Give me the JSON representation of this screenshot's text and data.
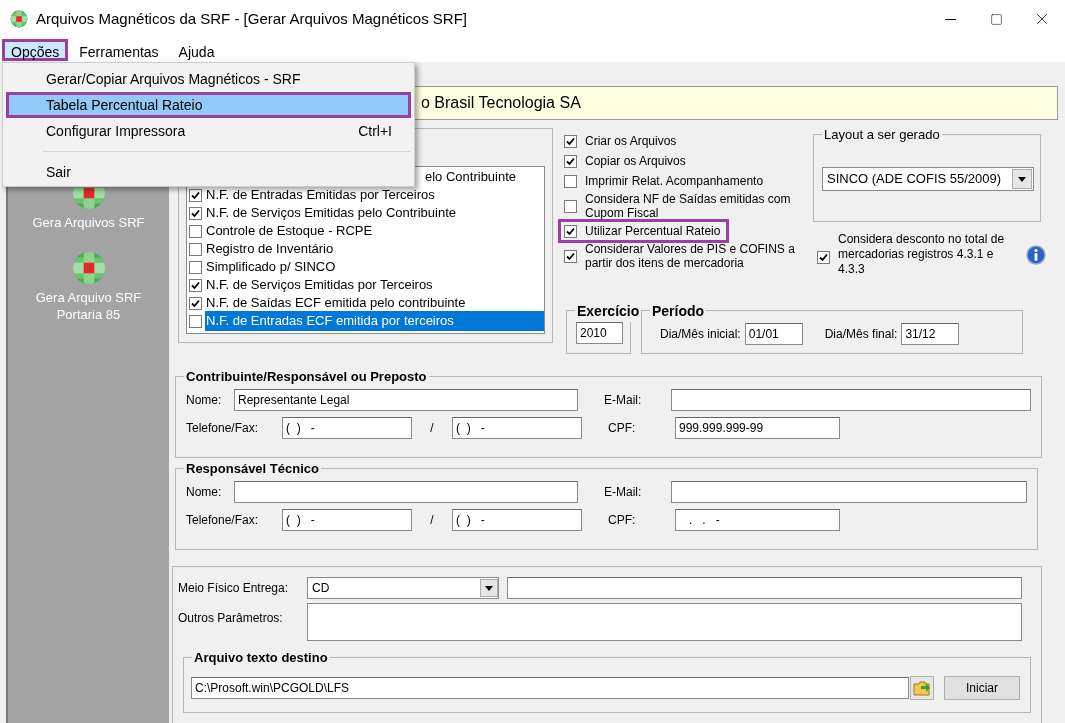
{
  "window": {
    "title": "Arquivos Magnéticos da SRF - [Gerar Arquivos Magnéticos SRF]"
  },
  "menu_bar": [
    {
      "label": "Opções",
      "selected": true,
      "highlighted": true
    },
    {
      "label": "Ferramentas",
      "selected": false,
      "highlighted": false
    },
    {
      "label": "Ajuda",
      "selected": false,
      "highlighted": false
    }
  ],
  "menu": {
    "items": [
      {
        "kind": "item",
        "label": "Gerar/Copiar Arquivos Magnéticos - SRF",
        "selected": false,
        "highlighted": false
      },
      {
        "kind": "item",
        "label": "Tabela Percentual Rateio",
        "selected": true,
        "highlighted": true
      },
      {
        "kind": "item",
        "label": "Configurar Impressora",
        "shortcut": "Ctrl+I",
        "selected": false,
        "highlighted": false
      },
      {
        "kind": "separator"
      },
      {
        "kind": "item",
        "label": "Sair",
        "selected": false,
        "highlighted": false
      }
    ]
  },
  "sidebar": {
    "items": [
      {
        "label": "Gera Arquivos SRF"
      },
      {
        "label": "Gera Arquivo SRF Portaria 85"
      }
    ]
  },
  "company_field": {
    "value": "o Brasil Tecnologia SA"
  },
  "file_list": {
    "items": [
      {
        "kind": "cut",
        "label": "elo Contribuinte"
      },
      {
        "kind": "row",
        "label": "N.F. de Entradas Emitidas por Terceiros",
        "checked": true,
        "selected": false
      },
      {
        "kind": "row",
        "label": "N.F. de Serviços Emitidas pelo Contribuinte",
        "checked": true,
        "selected": false
      },
      {
        "kind": "row",
        "label": "Controle de Estoque - RCPE",
        "checked": false,
        "selected": false
      },
      {
        "kind": "row",
        "label": "Registro de Inventário",
        "checked": false,
        "selected": false
      },
      {
        "kind": "row",
        "label": "Simplificado p/ SINCO",
        "checked": false,
        "selected": false
      },
      {
        "kind": "row",
        "label": "N.F. de Serviços Emitidas por Terceiros",
        "checked": true,
        "selected": false
      },
      {
        "kind": "row",
        "label": "N.F. de Saídas ECF emitida pelo contribuinte",
        "checked": true,
        "selected": false
      },
      {
        "kind": "row",
        "label": "N.F. de Entradas ECF emitida por terceiros",
        "checked": false,
        "selected": true
      }
    ]
  },
  "options": [
    {
      "label": "Criar os Arquivos",
      "checked": true,
      "highlighted": false
    },
    {
      "label": "Copiar os Arquivos",
      "checked": true,
      "highlighted": false
    },
    {
      "label": "Imprimir Relat. Acompanhamento",
      "checked": false,
      "highlighted": false
    },
    {
      "label": "Considera NF de Saídas emitidas com Cupom Fiscal",
      "checked": false,
      "highlighted": false
    },
    {
      "label": "Utilizar Percentual Rateio",
      "checked": true,
      "highlighted": true
    },
    {
      "label": "Considerar Valores de PIS e COFINS a partir dos itens de mercadoria",
      "checked": true,
      "highlighted": false
    }
  ],
  "layout_group": {
    "title": "Layout a ser gerado",
    "value": "SINCO (ADE COFIS 55/2009)"
  },
  "discount_option": {
    "label": "Considera desconto no total de mercadorias registros 4.3.1 e 4.3.3",
    "checked": true
  },
  "exercicio": {
    "title": "Exercício",
    "value": "2010"
  },
  "periodo": {
    "title": "Período",
    "start_label": "Dia/Mês inicial:",
    "start": "01/01",
    "end_label": "Dia/Mês final:",
    "end": "31/12"
  },
  "contribuinte": {
    "title": "Contribuinte/Responsável ou Preposto",
    "name_label": "Nome:",
    "name": "Representante Legal",
    "phone_label": "Telefone/Fax:",
    "phone": "(  )   -",
    "separator": "/",
    "fax": "(  )   -",
    "email_label": "E-Mail:",
    "cpf_label": "CPF:",
    "cpf": "999.999.999-99"
  },
  "responsavel": {
    "title": "Responsável Técnico",
    "name_label": "Nome:",
    "phone_label": "Telefone/Fax:",
    "phone": "(  )   -",
    "separator": "/",
    "fax": "(  )   -",
    "email_label": "E-Mail:",
    "cpf_label": "CPF:",
    "cpf": "   .   .   -"
  },
  "delivery": {
    "medium_label": "Meio Físico Entrega:",
    "medium": "CD",
    "other_label": "Outros Parâmetros:"
  },
  "destination": {
    "title": "Arquivo texto destino",
    "path": "C:\\Prosoft.win\\PCGOLD\\LFS",
    "button": "Iniciar"
  }
}
